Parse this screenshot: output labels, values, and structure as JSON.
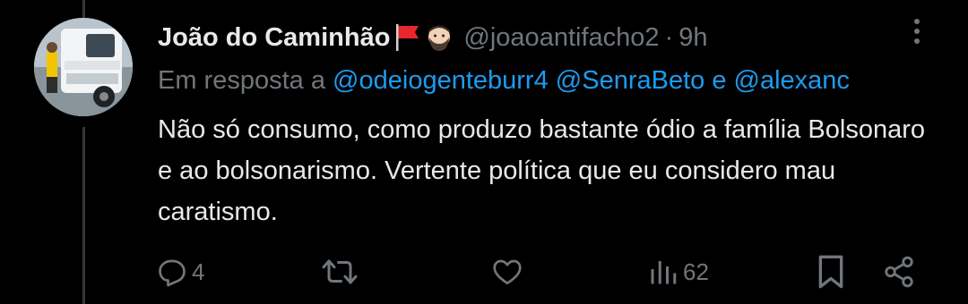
{
  "tweet": {
    "author_name": "João do Caminhão",
    "author_emojis": [
      "red-flag-emoji",
      "bearded-person-emoji"
    ],
    "handle": "@joaoantifacho2",
    "separator": "·",
    "time": "9h",
    "reply_prefix": "Em resposta a",
    "mentions": [
      "@odeiogenteburr4",
      "@SenraBeto"
    ],
    "mention_joiner": "e",
    "mention_last": "@alexanc",
    "text": "Não só consumo, como produzo bastante ódio a família Bolsonaro e ao bolsonarismo. Vertente política que eu considero mau caratismo."
  },
  "actions": {
    "reply_count": "4",
    "views_count": "62"
  },
  "colors": {
    "background": "#000000",
    "text": "#e7e9ea",
    "muted": "#71767b",
    "link": "#1d9bf0"
  }
}
